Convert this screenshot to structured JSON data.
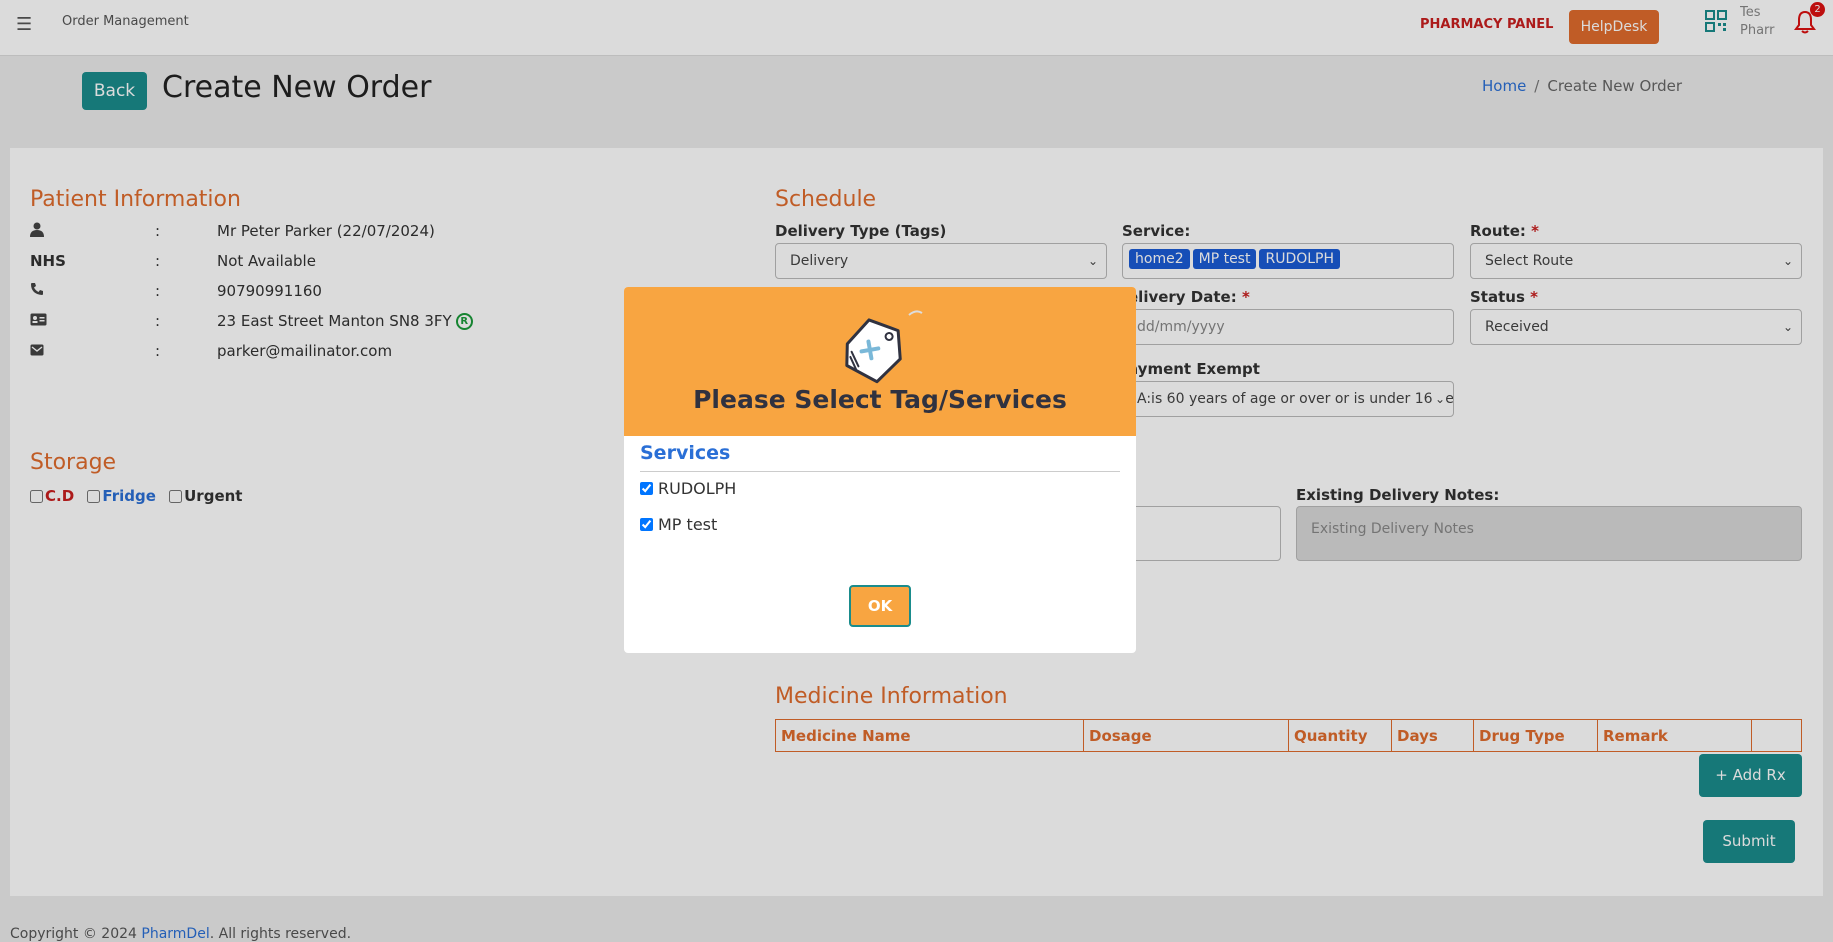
{
  "nav": {
    "app_title": "Order Management",
    "panel_label": "PHARMACY PANEL",
    "helpdesk_label": "HelpDesk",
    "avatar_alt": "Tes Pharr",
    "notification_count": "2"
  },
  "header": {
    "back_label": "Back",
    "title": "Create New Order",
    "breadcrumb_home": "Home",
    "breadcrumb_sep": "/",
    "breadcrumb_current": "Create New Order"
  },
  "patient": {
    "title": "Patient Information",
    "name": "Mr Peter Parker (22/07/2024)",
    "nhs_label": "NHS",
    "nhs_value": "Not Available",
    "phone": "90790991160",
    "address": "23 East Street Manton SN8 3FY",
    "rx_badge": "R",
    "email": "parker@mailinator.com",
    "colon": ":"
  },
  "storage": {
    "title": "Storage",
    "cd": "C.D",
    "fridge": "Fridge",
    "urgent": "Urgent"
  },
  "schedule": {
    "title": "Schedule",
    "delivery_type_label": "Delivery Type (Tags)",
    "delivery_type_value": "Delivery",
    "service_label": "Service:",
    "service_tags": [
      "home2",
      "MP test",
      "RUDOLPH"
    ],
    "route_label": "Route:",
    "route_value": "Select Route",
    "delivery_date_label": "elivery Date:",
    "delivery_date_placeholder": "dd/mm/yyyy",
    "status_label": "Status",
    "status_value": "Received",
    "payment_exempt_label": "ayment Exempt",
    "payment_exempt_value": "A:is 60 years of age or over or is under 16 yea",
    "required_mark": "*",
    "existing_notes_label": "Existing Delivery Notes:",
    "existing_notes_placeholder": "Existing Delivery Notes"
  },
  "medicine": {
    "title": "Medicine Information",
    "columns": [
      "Medicine Name",
      "Dosage",
      "Quantity",
      "Days",
      "Drug Type",
      "Remark",
      ""
    ],
    "add_rx_label": "+ Add Rx",
    "submit_label": "Submit"
  },
  "footer": {
    "prefix": "Copyright © 2024 ",
    "brand": "PharmDel",
    "suffix": ". All rights reserved."
  },
  "modal": {
    "title": "Please Select Tag/Services",
    "services_heading": "Services",
    "services": [
      {
        "label": "RUDOLPH",
        "checked": true
      },
      {
        "label": "MP test",
        "checked": true
      }
    ],
    "ok_label": "OK"
  },
  "colors": {
    "accent_orange": "#e06c2d",
    "modal_orange": "#f8a541",
    "teal": "#1a8c8c",
    "link_blue": "#2a6fd6"
  }
}
